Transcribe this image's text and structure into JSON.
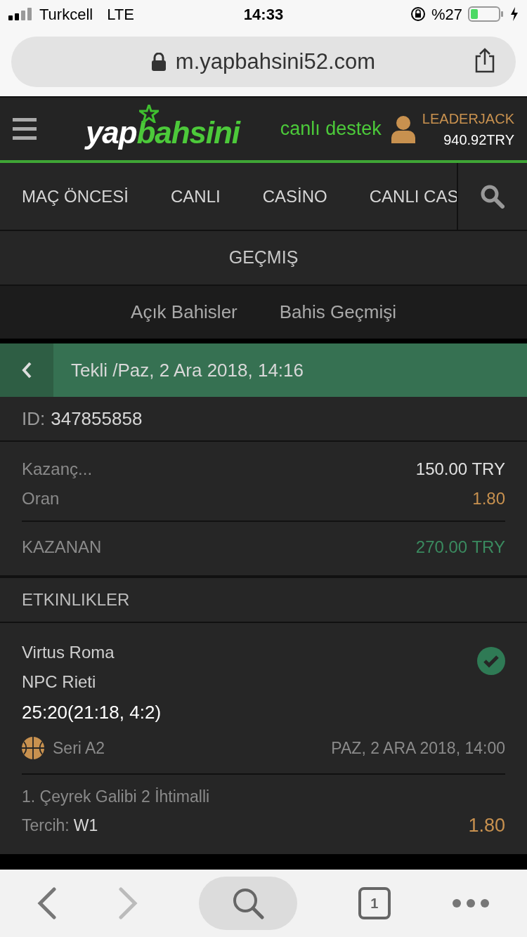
{
  "status_bar": {
    "carrier": "Turkcell",
    "network": "LTE",
    "time": "14:33",
    "battery_text": "%27"
  },
  "browser": {
    "url": "m.yapbahsini52.com"
  },
  "header": {
    "logo_left": "yap",
    "logo_right": "bahsini",
    "support": "canlı destek",
    "username": "LEADERJACK",
    "balance": "940.92TRY"
  },
  "nav_tabs": [
    {
      "label": "MAÇ ÖNCESİ",
      "selected": false
    },
    {
      "label": "CANLI",
      "selected": false
    },
    {
      "label": "CASİNO",
      "selected": false
    },
    {
      "label": "CANLI CAS",
      "selected": false
    }
  ],
  "section_title": "GEÇMIŞ",
  "sub_tabs": [
    {
      "label": "Açık Bahisler",
      "selected": false
    },
    {
      "label": "Bahis Geçmişi",
      "selected": false
    }
  ],
  "bet": {
    "title": "Tekli /Paz, 2 Ara 2018, 14:16",
    "id_label": "ID:",
    "id": "347855858",
    "rows": [
      {
        "label": "Kazanç...",
        "value": "150.00 TRY",
        "kind": "plain"
      },
      {
        "label": "Oran",
        "value": "1.80",
        "kind": "odds"
      },
      {
        "label": "KAZANAN",
        "value": "270.00 TRY",
        "kind": "win"
      }
    ]
  },
  "events_title": "ETKINLIKLER",
  "events": [
    {
      "team1": "Virtus Roma",
      "team2": "NPC Rieti",
      "score": "25:20(21:18, 4:2)",
      "won": true,
      "league": "Seri A2",
      "date": "PAZ, 2 ARA 2018, 14:00",
      "market": "1. Çeyrek Galibi 2 İhtimalli",
      "pick_label": "Tercih:",
      "pick": "W1",
      "odds": "1.80"
    }
  ],
  "toolbar": {
    "tab_count": "1"
  }
}
